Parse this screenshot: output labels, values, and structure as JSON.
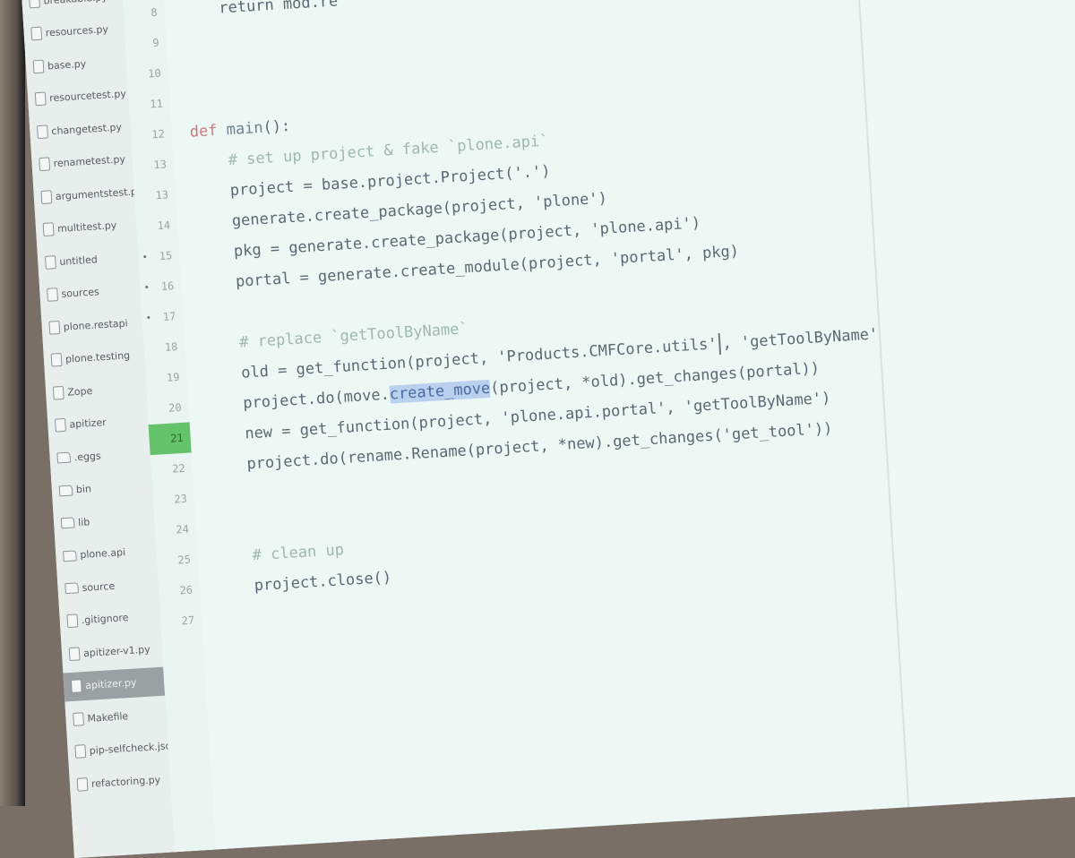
{
  "sidebar": {
    "items": [
      {
        "label": "breakable.py",
        "icon": "file-icon",
        "type": "file"
      },
      {
        "label": "resources.py",
        "icon": "file-icon",
        "type": "file"
      },
      {
        "label": "base.py",
        "icon": "file-icon",
        "type": "file"
      },
      {
        "label": "resourcetest.py",
        "icon": "file-icon",
        "type": "file"
      },
      {
        "label": "changetest.py",
        "icon": "file-icon",
        "type": "file"
      },
      {
        "label": "renametest.py",
        "icon": "file-icon",
        "type": "file"
      },
      {
        "label": "argumentstest.py",
        "icon": "file-icon",
        "type": "file"
      },
      {
        "label": "multitest.py",
        "icon": "file-icon",
        "type": "file"
      },
      {
        "label": "untitled",
        "icon": "file-icon",
        "type": "file"
      },
      {
        "label": "sources",
        "icon": "file-icon",
        "type": "file"
      },
      {
        "label": "plone.restapi",
        "icon": "file-icon",
        "type": "file"
      },
      {
        "label": "plone.testing",
        "icon": "file-icon",
        "type": "file"
      },
      {
        "label": "Zope",
        "icon": "file-icon",
        "type": "file"
      },
      {
        "label": "apitizer",
        "icon": "file-icon",
        "type": "file"
      },
      {
        "label": ".eggs",
        "icon": "folder-icon",
        "type": "folder"
      },
      {
        "label": "bin",
        "icon": "folder-icon",
        "type": "folder"
      },
      {
        "label": "lib",
        "icon": "folder-icon",
        "type": "folder"
      },
      {
        "label": "plone.api",
        "icon": "folder-icon",
        "type": "folder"
      },
      {
        "label": "source",
        "icon": "folder-icon",
        "type": "folder"
      },
      {
        "label": ".gitignore",
        "icon": "file-icon",
        "type": "file"
      },
      {
        "label": "apitizer-v1.py",
        "icon": "file-icon",
        "type": "file"
      },
      {
        "label": "apitizer.py",
        "icon": "file-icon",
        "type": "file",
        "selected": true
      },
      {
        "label": "Makefile",
        "icon": "file-icon",
        "type": "file"
      },
      {
        "label": "pip-selfcheck.json",
        "icon": "file-icon",
        "type": "file"
      },
      {
        "label": "refactoring.py",
        "icon": "file-icon",
        "type": "file"
      }
    ]
  },
  "editor": {
    "current_line": "21",
    "lines": [
      {
        "num": "8",
        "marked": false,
        "segments": [
          {
            "t": "    return mod.re",
            "c": ""
          }
        ]
      },
      {
        "num": "9",
        "marked": false,
        "segments": []
      },
      {
        "num": "10",
        "marked": false,
        "segments": []
      },
      {
        "num": "11",
        "marked": false,
        "segments": []
      },
      {
        "num": "12",
        "marked": false,
        "segments": [
          {
            "t": "def ",
            "c": "kw"
          },
          {
            "t": "main",
            "c": "fn"
          },
          {
            "t": "():",
            "c": ""
          }
        ]
      },
      {
        "num": "13",
        "marked": false,
        "segments": [
          {
            "t": "    # set up project & fake `plone.api`",
            "c": "comment"
          }
        ]
      },
      {
        "num": "13",
        "marked": false,
        "segments": [
          {
            "t": "    project = base.project.Project('.')",
            "c": ""
          }
        ]
      },
      {
        "num": "14",
        "marked": false,
        "segments": [
          {
            "t": "    generate.create_package(project, 'plone')",
            "c": ""
          }
        ]
      },
      {
        "num": "15",
        "marked": true,
        "segments": [
          {
            "t": "    pkg = generate.create_package(project, 'plone.api')",
            "c": ""
          }
        ]
      },
      {
        "num": "16",
        "marked": true,
        "segments": [
          {
            "t": "    portal = generate.create_module(project, 'portal', pkg)",
            "c": ""
          }
        ]
      },
      {
        "num": "17",
        "marked": true,
        "segments": []
      },
      {
        "num": "18",
        "marked": false,
        "segments": [
          {
            "t": "    # replace `getToolByName`",
            "c": "comment"
          }
        ]
      },
      {
        "num": "19",
        "marked": false,
        "segments": [
          {
            "t": "    old = get_function(project, 'Products.CMFCore.utils'",
            "c": ""
          },
          {
            "t": "",
            "c": "cursor"
          },
          {
            "t": ", 'getToolByName')",
            "c": ""
          }
        ]
      },
      {
        "num": "20",
        "marked": false,
        "segments": [
          {
            "t": "    project.do(move.",
            "c": ""
          },
          {
            "t": "create_move",
            "c": "sel"
          },
          {
            "t": "(project, *old).get_changes(portal))",
            "c": ""
          }
        ]
      },
      {
        "num": "21",
        "marked": false,
        "segments": [
          {
            "t": "    new = get_function(project, 'plone.api.portal', 'getToolByName')",
            "c": ""
          }
        ]
      },
      {
        "num": "22",
        "marked": false,
        "segments": [
          {
            "t": "    project.do(rename.Rename(project, *new).get_changes('get_tool'))",
            "c": ""
          }
        ]
      },
      {
        "num": "23",
        "marked": false,
        "segments": []
      },
      {
        "num": "24",
        "marked": false,
        "segments": []
      },
      {
        "num": "25",
        "marked": false,
        "segments": [
          {
            "t": "    # clean up",
            "c": "comment"
          }
        ]
      },
      {
        "num": "26",
        "marked": false,
        "segments": [
          {
            "t": "    project.close()",
            "c": ""
          }
        ]
      },
      {
        "num": "27",
        "marked": false,
        "segments": []
      }
    ]
  }
}
